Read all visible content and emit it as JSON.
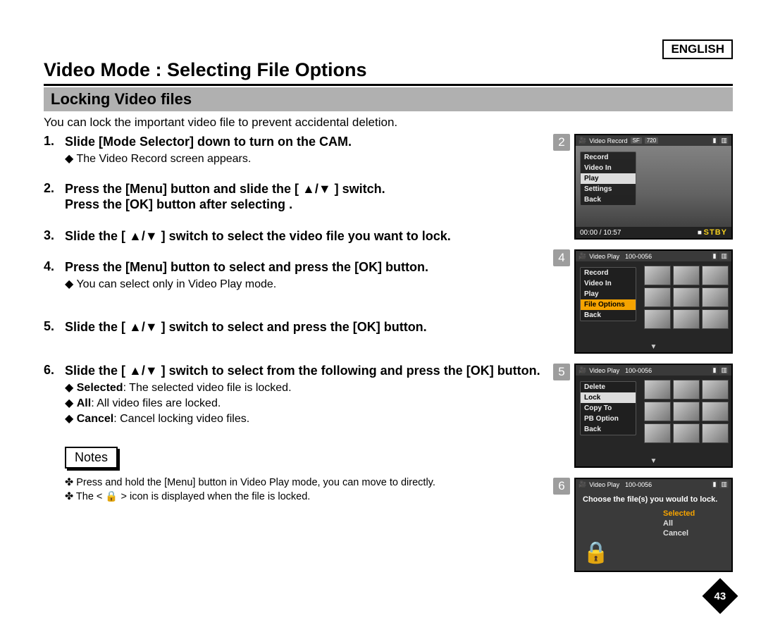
{
  "header": {
    "language": "ENGLISH",
    "title": "Video Mode : Selecting File Options",
    "subtitle": "Locking Video files"
  },
  "intro": "You can lock the important video file to prevent accidental deletion.",
  "steps": [
    {
      "title": "Slide [Mode Selector] down to turn on the CAM.",
      "subs": [
        "The Video Record screen appears."
      ]
    },
    {
      "title": "Press the [Menu] button and slide the [ ▲/▼ ] switch.\nPress the [OK] button after selecting <Play>.",
      "subs": []
    },
    {
      "title": "Slide the [ ▲/▼ ] switch to select the video file you want to lock.",
      "subs": []
    },
    {
      "title": "Press the [Menu] button to select <File Options> and press the [OK] button.",
      "subs": [
        "You can select <File Options> only in Video Play mode."
      ]
    },
    {
      "title": "Slide the [ ▲/▼ ] switch to select <Lock> and press the [OK] button.",
      "subs": []
    },
    {
      "title": "Slide the [ ▲/▼ ] switch to select from the following and press the [OK] button.",
      "subs": [
        "<b>Selected</b>: The selected video file is locked.",
        "<b>All</b>: All video files are locked.",
        "<b>Cancel</b>: Cancel locking video files."
      ]
    }
  ],
  "notesHeader": "Notes",
  "notes": [
    "Press and hold the [Menu] button in Video Play mode, you can move to <File Options> directly.",
    "The < 🔒 > icon is displayed when the file is locked."
  ],
  "screens": {
    "s2": {
      "num": "2",
      "title": "Video Record",
      "badges": [
        "SF",
        "720"
      ],
      "menu": [
        "Record",
        "Video In",
        "Play",
        "Settings",
        "Back"
      ],
      "sel": 2,
      "timer": "00:00 / 10:57",
      "status": "STBY",
      "stop": "■"
    },
    "s4": {
      "num": "4",
      "title": "Video Play",
      "code": "100-0056",
      "menu": [
        "Record",
        "Video In",
        "Play",
        "File Options",
        "Back"
      ],
      "sel": 3
    },
    "s5": {
      "num": "5",
      "title": "Video Play",
      "code": "100-0056",
      "menu": [
        "Delete",
        "Lock",
        "Copy To",
        "PB Option",
        "Back"
      ],
      "sel": 1
    },
    "s6": {
      "num": "6",
      "title": "Video Play",
      "code": "100-0056",
      "msg": "Choose the file(s) you would to lock.",
      "options": [
        "Selected",
        "All",
        "Cancel"
      ],
      "sel": 0
    }
  },
  "pageNumber": "43"
}
